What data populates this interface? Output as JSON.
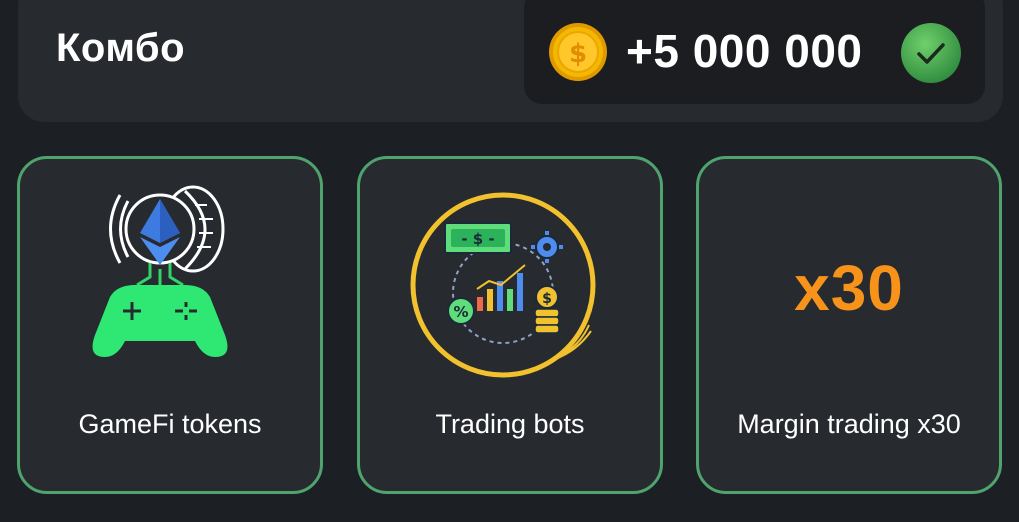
{
  "combo": {
    "title": "Комбо",
    "reward": "+5 000 000",
    "coin_icon": "dollar-coin-icon",
    "status_icon": "checkmark-icon",
    "status_color": "#3da14d"
  },
  "cards": [
    {
      "label": "GameFi tokens",
      "icon": "gamepad-ethereum-icon"
    },
    {
      "label": "Trading bots",
      "icon": "trading-bot-chart-icon"
    },
    {
      "label": "Margin trading x30",
      "icon": "x30-text-icon",
      "badge": "x30"
    }
  ],
  "colors": {
    "card_border": "#4fa36d",
    "accent_orange": "#f7931a",
    "coin_gold": "#f5b800"
  }
}
